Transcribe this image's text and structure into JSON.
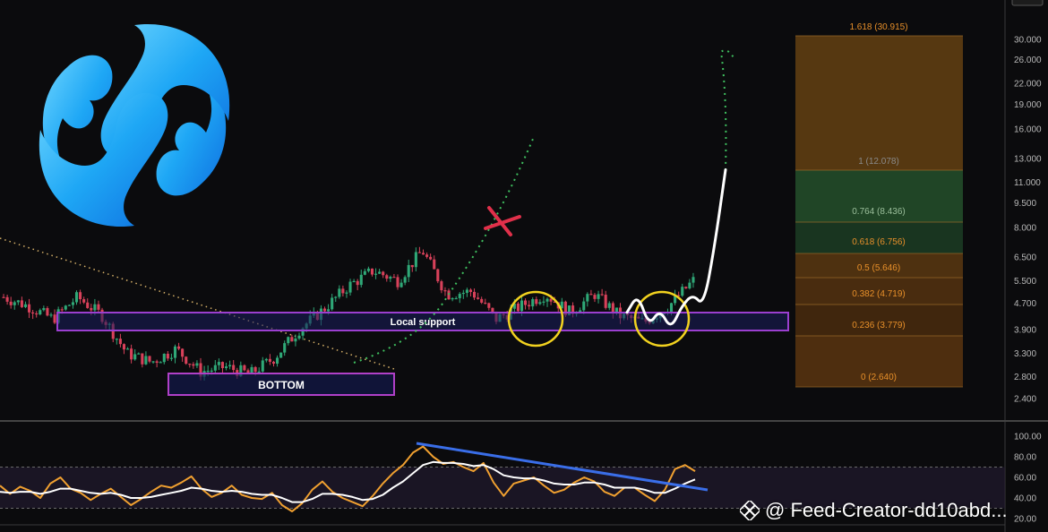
{
  "chart_data": [
    {
      "type": "candlestick",
      "y_scale": "log",
      "ylim": [
        2.2,
        34
      ],
      "y_ticks": [
        "30.000",
        "26.000",
        "22.000",
        "19.000",
        "16.000",
        "13.000",
        "11.000",
        "9.500",
        "8.000",
        "6.500",
        "5.500",
        "4.700",
        "3.900",
        "3.300",
        "2.800",
        "2.400"
      ],
      "price_path": [
        4.9,
        4.6,
        4.2,
        4.9,
        4.3,
        3.3,
        3.1,
        3.4,
        2.9,
        3.0,
        2.85,
        3.2,
        3.9,
        4.5,
        5.3,
        5.9,
        5.5,
        6.8,
        5.0,
        5.1,
        4.2,
        4.6,
        5.0,
        4.4,
        5.0,
        4.3,
        4.1,
        4.6,
        5.5
      ],
      "projection_path": [
        4.4,
        5.0,
        4.0,
        4.5,
        3.9,
        4.6,
        5.0,
        4.6,
        7.0,
        12.0
      ],
      "boxes": [
        {
          "label": "Local support",
          "low": 3.8,
          "high": 4.3
        },
        {
          "label": "BOTTOM",
          "low": 2.7,
          "high": 2.95
        }
      ],
      "fibonacci": [
        {
          "ratio": "1.618",
          "price": "30.915",
          "label": "1.618 (30.915)"
        },
        {
          "ratio": "1",
          "price": "12.078",
          "label": "1 (12.078)"
        },
        {
          "ratio": "0.764",
          "price": "8.436",
          "label": "0.764 (8.436)"
        },
        {
          "ratio": "0.618",
          "price": "6.756",
          "label": "0.618 (6.756)"
        },
        {
          "ratio": "0.5",
          "price": "5.646",
          "label": "0.5 (5.646)"
        },
        {
          "ratio": "0.382",
          "price": "4.719",
          "label": "0.382 (4.719)"
        },
        {
          "ratio": "0.236",
          "price": "3.779",
          "label": "0.236 (3.779)"
        },
        {
          "ratio": "0",
          "price": "2.640",
          "label": "0 (2.640)"
        }
      ]
    },
    {
      "type": "line",
      "indicator": "oscillator",
      "ylim": [
        20,
        100
      ],
      "y_ticks": [
        "100.00",
        "80.00",
        "60.00",
        "40.00",
        "20.00"
      ],
      "series": [
        {
          "color": "#f0a030",
          "values": [
            52,
            44,
            51,
            47,
            40,
            54,
            60,
            49,
            45,
            38,
            44,
            49,
            41,
            33,
            39,
            46,
            52,
            50,
            55,
            61,
            49,
            41,
            45,
            52,
            43,
            40,
            39,
            45,
            33,
            27,
            35,
            48,
            56,
            46,
            40,
            36,
            32,
            42,
            54,
            64,
            72,
            84,
            90,
            80,
            73,
            75,
            70,
            66,
            74,
            55,
            42,
            54,
            57,
            60,
            52,
            45,
            48,
            55,
            60,
            56,
            46,
            42,
            50,
            50,
            43,
            37,
            48,
            68,
            72,
            66
          ]
        },
        {
          "color": "#ffffff",
          "values": [
            46,
            45,
            46,
            46,
            44,
            46,
            49,
            49,
            47,
            45,
            44,
            45,
            43,
            40,
            40,
            41,
            43,
            45,
            47,
            50,
            49,
            47,
            46,
            47,
            46,
            44,
            43,
            43,
            40,
            36,
            36,
            39,
            44,
            44,
            43,
            41,
            38,
            39,
            43,
            50,
            56,
            64,
            72,
            75,
            74,
            74,
            73,
            71,
            72,
            68,
            62,
            60,
            59,
            59,
            57,
            54,
            53,
            53,
            55,
            55,
            53,
            50,
            50,
            50,
            48,
            45,
            45,
            49,
            54,
            58
          ]
        }
      ],
      "threshold_lines": [
        70,
        30
      ]
    }
  ],
  "watermark": {
    "text": "@ Feed-Creator-dd10abd..."
  }
}
